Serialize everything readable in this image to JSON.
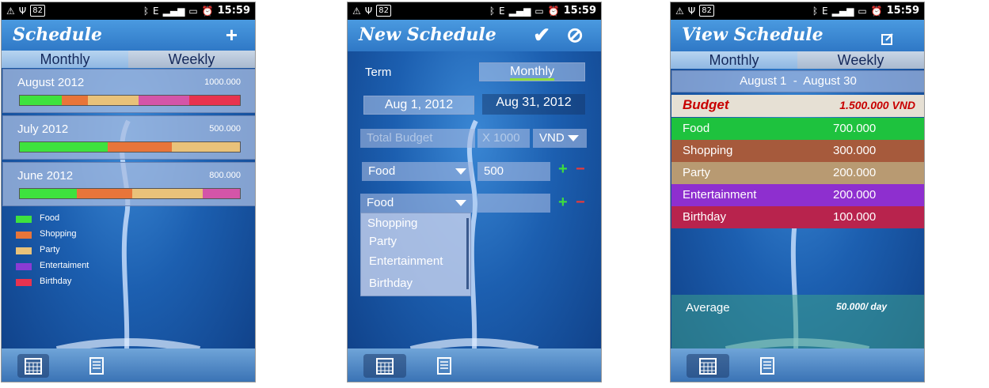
{
  "status_bar": {
    "battery": "82",
    "signal_letter": "E",
    "time": "15:59"
  },
  "screen1": {
    "title": "Schedule",
    "add_label": "+",
    "tabs": [
      "Monthly",
      "Weekly"
    ],
    "months": [
      {
        "name": "August 2012",
        "amount": "1000.000",
        "segments": [
          {
            "color": "#3ee23e",
            "share": 0.19
          },
          {
            "color": "#e8753a",
            "share": 0.12
          },
          {
            "color": "#e9c27a",
            "share": 0.23
          },
          {
            "color": "#d455a8",
            "share": 0.23
          },
          {
            "color": "#e8334f",
            "share": 0.23
          }
        ]
      },
      {
        "name": "July 2012",
        "amount": "500.000",
        "segments": [
          {
            "color": "#3ee23e",
            "share": 0.4
          },
          {
            "color": "#e8753a",
            "share": 0.29
          },
          {
            "color": "#e9c27a",
            "share": 0.31
          }
        ]
      },
      {
        "name": "June 2012",
        "amount": "800.000",
        "segments": [
          {
            "color": "#3ee23e",
            "share": 0.26
          },
          {
            "color": "#e8753a",
            "share": 0.25
          },
          {
            "color": "#e9c27a",
            "share": 0.32
          },
          {
            "color": "#d455a8",
            "share": 0.17
          }
        ]
      }
    ],
    "legend": [
      {
        "label": "Food",
        "color": "#3ee23e"
      },
      {
        "label": "Shopping",
        "color": "#e8753a"
      },
      {
        "label": "Party",
        "color": "#e9c27a"
      },
      {
        "label": "Entertaiment",
        "color": "#8b3bd4"
      },
      {
        "label": "Birthday",
        "color": "#e8334f"
      }
    ]
  },
  "screen2": {
    "title": "New Schedule",
    "confirm_icon": "✔",
    "cancel_icon": "⊘",
    "term_label": "Term",
    "term_value": "Monthly",
    "start_date": "Aug 1, 2012",
    "end_date": "Aug 31, 2012",
    "total_budget_placeholder": "Total Budget",
    "multiplier": "X 1000",
    "currency": "VND",
    "row1_category": "Food",
    "row1_value": "500",
    "row2_category": "Food",
    "plus": "+",
    "minus": "−",
    "dropdown_options": [
      "Shopping",
      "Party",
      "Entertainment",
      "Birthday"
    ]
  },
  "screen3": {
    "title": "View Schedule",
    "tabs": [
      "Monthly",
      "Weekly"
    ],
    "range_start": "August 1",
    "range_sep": "-",
    "range_end": "August 30",
    "budget_label": "Budget",
    "budget_value": "1.500.000 VND",
    "categories": [
      {
        "label": "Food",
        "value": "700.000",
        "color": "#1ec23e"
      },
      {
        "label": "Shopping",
        "value": "300.000",
        "color": "#a65a3c"
      },
      {
        "label": "Party",
        "value": "200.000",
        "color": "#b89a72"
      },
      {
        "label": "Entertainment",
        "value": "200.000",
        "color": "#8e2fcf"
      },
      {
        "label": "Birthday",
        "value": "100.000",
        "color": "#b8234d"
      }
    ],
    "average_label": "Average",
    "average_value": "50.000/ day"
  }
}
